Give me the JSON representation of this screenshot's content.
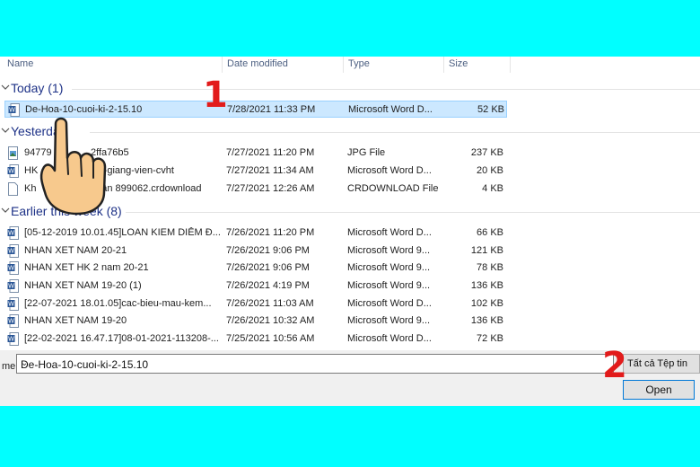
{
  "columns": {
    "name": "Name",
    "date": "Date modified",
    "type": "Type",
    "size": "Size"
  },
  "groups": {
    "today": "Today (1)",
    "yesterday": "Yesterday",
    "earlier": "Earlier this week (8)"
  },
  "rows": [
    {
      "name": "De-Hoa-10-cuoi-ki-2-15.10",
      "date": "7/28/2021 11:33 PM",
      "type": "Microsoft Word D...",
      "size": "52 KB",
      "icon": "word-icon"
    },
    {
      "name": "94779",
      "name2": "2ffa76b5",
      "date": "7/27/2021 11:20 PM",
      "type": "JPG File",
      "size": "237 KB",
      "icon": "image-file-icon"
    },
    {
      "name": "HK",
      "name2": "gia-giang-vien-cvht",
      "date": "7/27/2021 11:34 AM",
      "type": "Microsoft Word D...",
      "size": "20 KB",
      "icon": "word-icon"
    },
    {
      "name": "Kh",
      "name2": "nhận 899062.crdownload",
      "date": "7/27/2021 12:26 AM",
      "type": "CRDOWNLOAD File",
      "size": "4 KB",
      "icon": "blank-file-icon"
    },
    {
      "name": "[05-12-2019 10.01.45]LOAN KIEM DIỄM Đ...",
      "date": "7/26/2021 11:20 PM",
      "type": "Microsoft Word D...",
      "size": "66 KB",
      "icon": "word-icon"
    },
    {
      "name": "NHAN XET NAM 20-21",
      "date": "7/26/2021 9:06 PM",
      "type": "Microsoft Word 9...",
      "size": "121 KB",
      "icon": "word-icon"
    },
    {
      "name": "NHAN XET HK 2 nam 20-21",
      "date": "7/26/2021 9:06 PM",
      "type": "Microsoft Word 9...",
      "size": "78 KB",
      "icon": "word-icon"
    },
    {
      "name": "NHAN XET NAM 19-20 (1)",
      "date": "7/26/2021 4:19 PM",
      "type": "Microsoft Word 9...",
      "size": "136 KB",
      "icon": "word-icon"
    },
    {
      "name": "[22-07-2021 18.01.05]cac-bieu-mau-kem...",
      "date": "7/26/2021 11:03 AM",
      "type": "Microsoft Word D...",
      "size": "102 KB",
      "icon": "word-icon"
    },
    {
      "name": "NHAN XET NAM 19-20",
      "date": "7/26/2021 10:32 AM",
      "type": "Microsoft Word 9...",
      "size": "136 KB",
      "icon": "word-icon"
    },
    {
      "name": "[22-02-2021 16.47.17]08-01-2021-113208-...",
      "date": "7/25/2021 10:56 AM",
      "type": "Microsoft Word D...",
      "size": "72 KB",
      "icon": "word-icon"
    }
  ],
  "filename": {
    "label": "me:",
    "value": "De-Hoa-10-cuoi-ki-2-15.10"
  },
  "filter_label": "Tất cả Tệp tin",
  "open_label": "Open",
  "steps": {
    "one": "1",
    "two": "2"
  },
  "colors": {
    "background": "#00ffff",
    "group": "#1e3287",
    "selection": "#cce8ff",
    "step_marker": "#e21b1b"
  }
}
